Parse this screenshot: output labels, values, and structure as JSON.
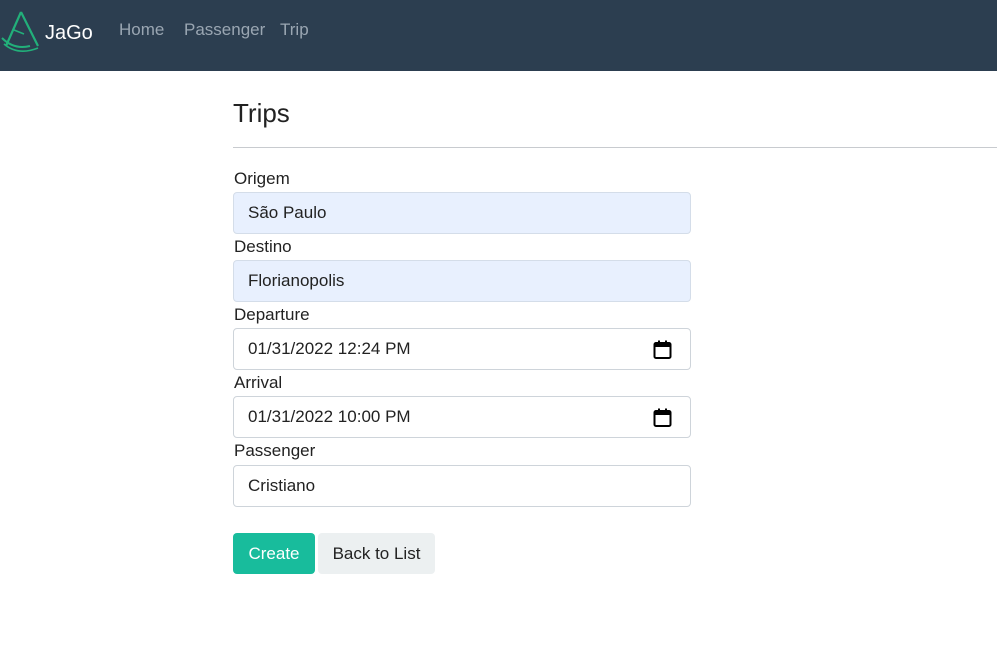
{
  "navbar": {
    "brand": "JaGo",
    "logo_icon": "triangle-logo-icon",
    "links": [
      "Home",
      "Passenger",
      "Trip"
    ]
  },
  "page": {
    "title": "Trips"
  },
  "form": {
    "origin": {
      "label": "Origem",
      "value": "São Paulo"
    },
    "destination": {
      "label": "Destino",
      "value": "Florianopolis"
    },
    "departure": {
      "label": "Departure",
      "value": "01/31/2022 12:24 PM",
      "icon": "calendar-icon"
    },
    "arrival": {
      "label": "Arrival",
      "value": "01/31/2022 10:00 PM",
      "icon": "calendar-icon"
    },
    "passenger": {
      "label": "Passenger",
      "value": "Cristiano"
    }
  },
  "buttons": {
    "create": "Create",
    "back": "Back to List"
  },
  "colors": {
    "navbar": "#2c3e50",
    "primary": "#18bc9c",
    "secondary": "#ecf0f1",
    "autofill": "#e8f0fe"
  }
}
